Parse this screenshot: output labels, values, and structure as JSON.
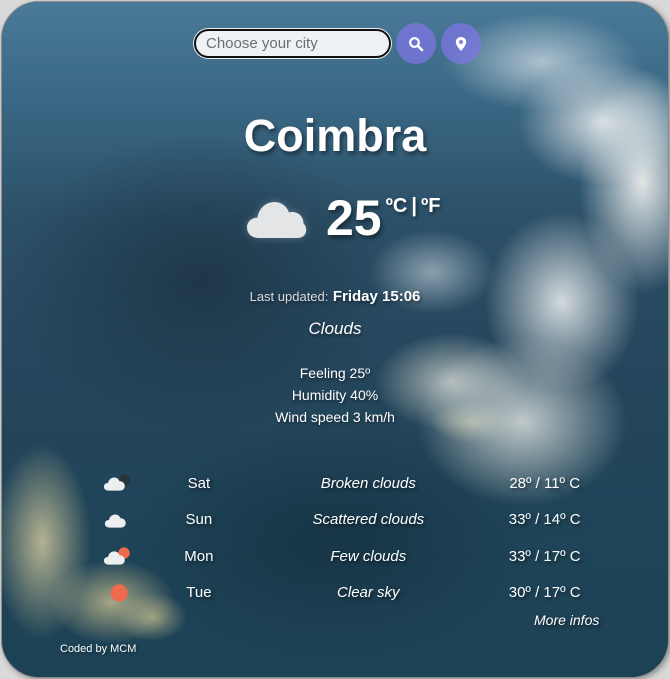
{
  "search": {
    "placeholder": "Choose your city",
    "value": "",
    "search_button_icon": "search-icon",
    "location_button_icon": "location-pin-icon"
  },
  "current": {
    "city": "Coimbra",
    "icon": "cloud-icon",
    "temperature": "25",
    "unit_celsius": "ºC",
    "unit_separator": "|",
    "unit_fahrenheit": "ºF",
    "last_updated_label": "Last updated:",
    "last_updated_value": "Friday 15:06",
    "description": "Clouds",
    "feeling": "Feeling 25º",
    "humidity": "Humidity 40%",
    "wind": "Wind speed 3 km/h"
  },
  "forecast": [
    {
      "icon": "broken-clouds-icon",
      "day": "Sat",
      "description": "Broken clouds",
      "temps": "28º / 11º C"
    },
    {
      "icon": "scattered-clouds-icon",
      "day": "Sun",
      "description": "Scattered clouds",
      "temps": "33º / 14º C"
    },
    {
      "icon": "few-clouds-icon",
      "day": "Mon",
      "description": "Few clouds",
      "temps": "33º / 17º C"
    },
    {
      "icon": "clear-sky-sun-icon",
      "day": "Tue",
      "description": "Clear sky",
      "temps": "30º / 17º C"
    }
  ],
  "more_link": "More infos",
  "footer": {
    "credit": "Coded by MCM"
  },
  "colors": {
    "button_accent": "#8076e6",
    "sun": "#ef6a4c",
    "cloud": "#e8eaec",
    "text": "#ffffff"
  }
}
